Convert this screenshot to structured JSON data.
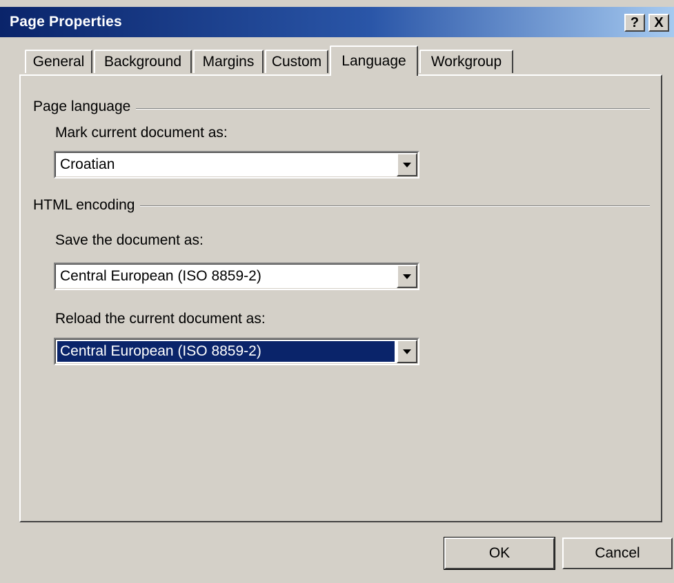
{
  "window": {
    "title": "Page Properties"
  },
  "titlebar_buttons": {
    "help": "?",
    "close": "X"
  },
  "tabs": [
    {
      "label": "General",
      "active": false
    },
    {
      "label": "Background",
      "active": false
    },
    {
      "label": "Margins",
      "active": false
    },
    {
      "label": "Custom",
      "active": false
    },
    {
      "label": "Language",
      "active": true
    },
    {
      "label": "Workgroup",
      "active": false
    }
  ],
  "page_language": {
    "group_label": "Page language",
    "mark_label": "Mark current document as:",
    "mark_value": "Croatian"
  },
  "html_encoding": {
    "group_label": "HTML encoding",
    "save_label": "Save the document as:",
    "save_value": "Central European (ISO 8859-2)",
    "reload_label": "Reload the current document as:",
    "reload_value": "Central European (ISO 8859-2)"
  },
  "buttons": {
    "ok": "OK",
    "cancel": "Cancel"
  },
  "colors": {
    "title_start": "#0a246a",
    "title_end": "#a6caf0",
    "dialog_bg": "#d4d0c8",
    "selection": "#0a246a"
  }
}
